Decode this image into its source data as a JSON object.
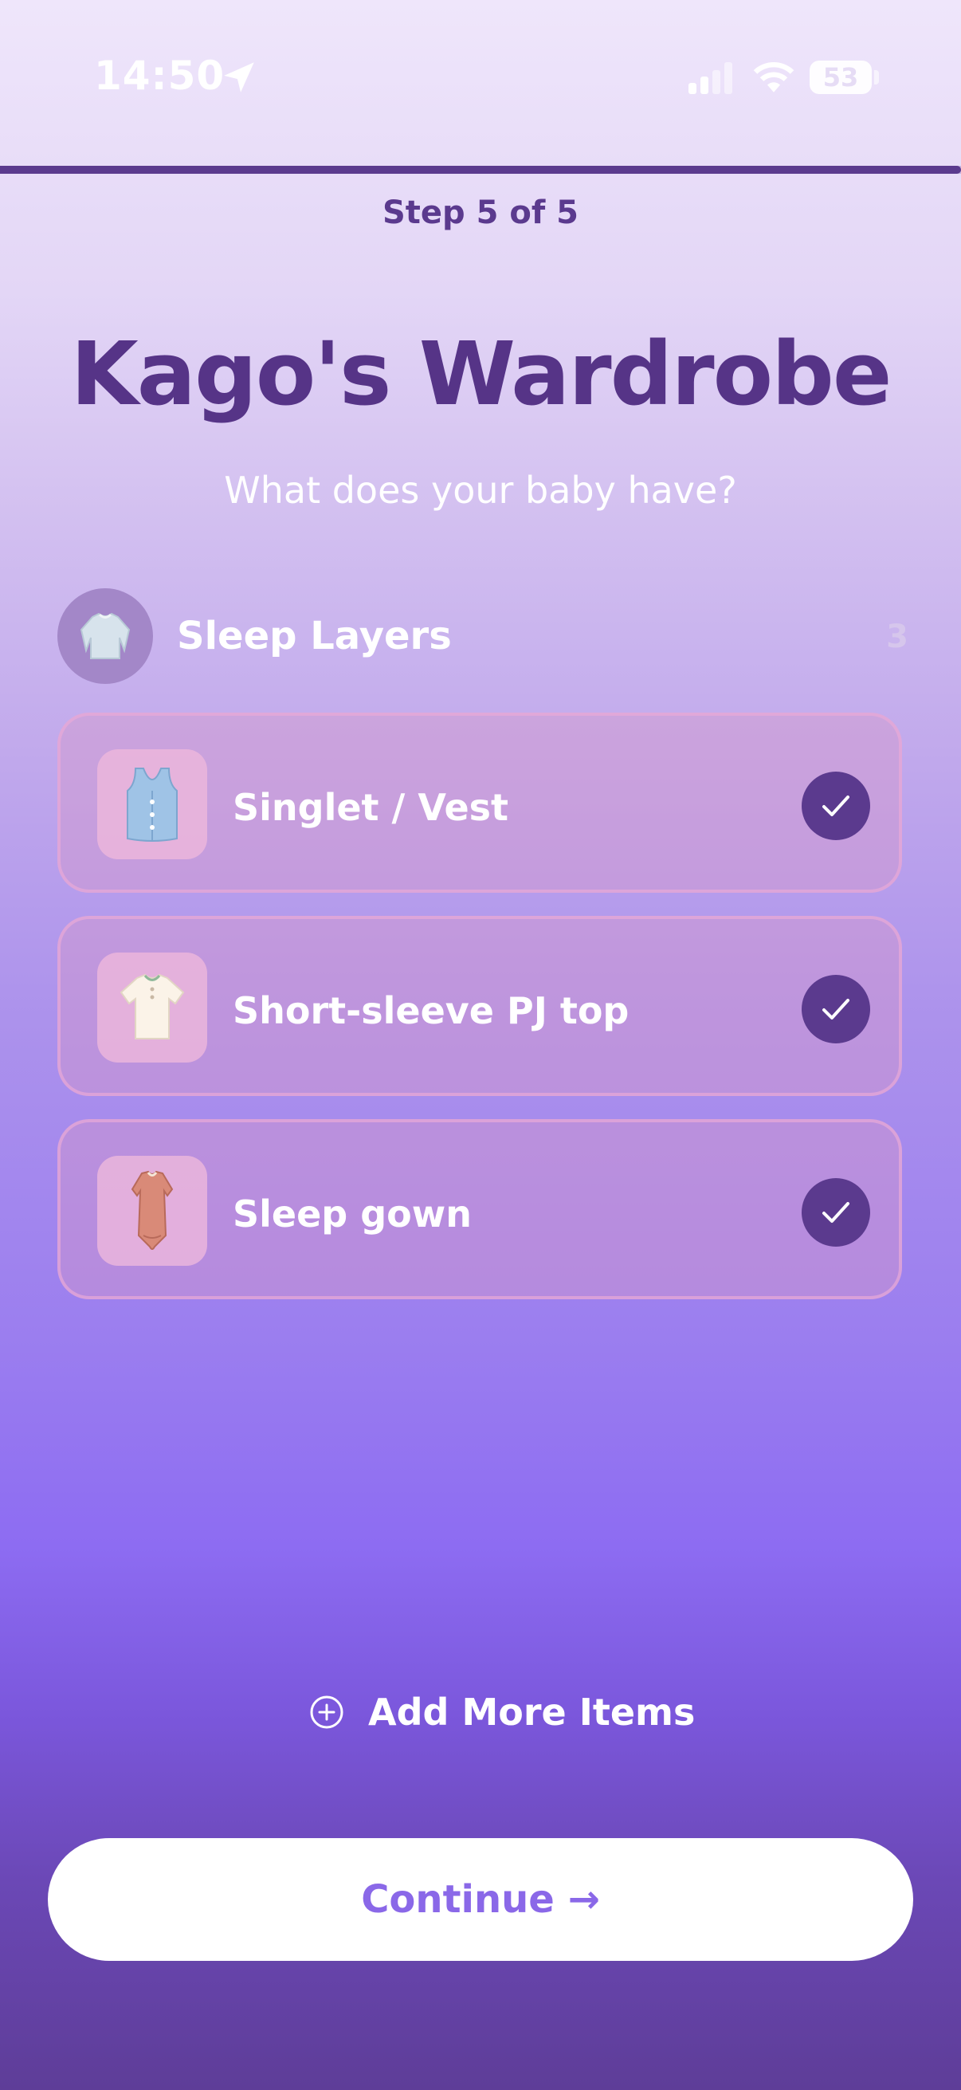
{
  "status_bar": {
    "time": "14:50",
    "battery": "53"
  },
  "progress": {
    "fraction": 1.0
  },
  "step_label": "Step 5 of 5",
  "title": "Kago's Wardrobe",
  "subtitle": "What does your baby have?",
  "category": {
    "label": "Sleep Layers",
    "count": "3",
    "icon": "long-sleeve-shirt-icon"
  },
  "items": [
    {
      "label": "Singlet / Vest",
      "icon": "vest-icon",
      "checked": true
    },
    {
      "label": "Short-sleeve PJ top",
      "icon": "tshirt-icon",
      "checked": true
    },
    {
      "label": "Sleep gown",
      "icon": "sleep-gown-icon",
      "checked": true
    }
  ],
  "add_more_label": "Add More Items",
  "continue_label": "Continue →",
  "colors": {
    "accent": "#5b3a8e",
    "button_text": "#8a68e8"
  }
}
